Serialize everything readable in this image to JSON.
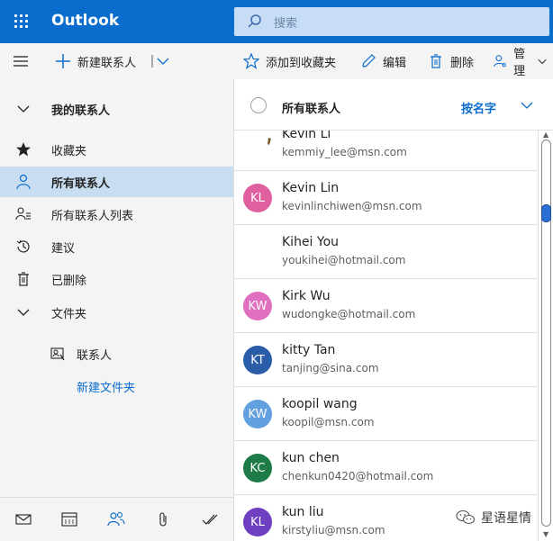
{
  "app": {
    "title": "Outlook"
  },
  "search": {
    "placeholder": "搜索"
  },
  "commands": {
    "new_contact": "新建联系人",
    "add_favorite": "添加到收藏夹",
    "edit": "编辑",
    "delete": "删除",
    "manage": "管理"
  },
  "nav": {
    "section_title": "我的联系人",
    "items": [
      {
        "label": "收藏夹",
        "icon": "star-icon"
      },
      {
        "label": "所有联系人",
        "icon": "person-icon",
        "selected": true
      },
      {
        "label": "所有联系人列表",
        "icon": "contact-list-icon"
      },
      {
        "label": "建议",
        "icon": "history-icon"
      },
      {
        "label": "已删除",
        "icon": "trash-icon"
      }
    ],
    "folders_title": "文件夹",
    "folder_contacts": "联系人",
    "new_folder": "新建文件夹"
  },
  "bottom_nav": [
    "mail-icon",
    "calendar-icon",
    "people-icon",
    "attachment-icon",
    "todo-icon"
  ],
  "list": {
    "title": "所有联系人",
    "sort_label": "按名字",
    "contacts": [
      {
        "name": "Kevin Li",
        "email": "kemmiy_lee@msn.com",
        "initials": "",
        "color": ""
      },
      {
        "name": "Kevin Lin",
        "email": "kevinlinchiwen@msn.com",
        "initials": "KL",
        "color": "#e0609f"
      },
      {
        "name": "Kihei You",
        "email": "youkihei@hotmail.com",
        "initials": "",
        "color": ""
      },
      {
        "name": "Kirk Wu",
        "email": "wudongke@hotmail.com",
        "initials": "KW",
        "color": "#e06fbf"
      },
      {
        "name": "kitty Tan",
        "email": "tanjing@sina.com",
        "initials": "KT",
        "color": "#2a5ca8"
      },
      {
        "name": "koopil wang",
        "email": "koopil@msn.com",
        "initials": "KW",
        "color": "#62a0e0"
      },
      {
        "name": "kun chen",
        "email": "chenkun0420@hotmail.com",
        "initials": "KC",
        "color": "#1e7b47"
      },
      {
        "name": "kun liu",
        "email": "kirstyliu@msn.com",
        "initials": "KL",
        "color": "#6e3fc0"
      }
    ]
  },
  "watermark": "星语星情",
  "colors": {
    "brand": "#0a6ccd",
    "selected": "#c8ddf1"
  }
}
